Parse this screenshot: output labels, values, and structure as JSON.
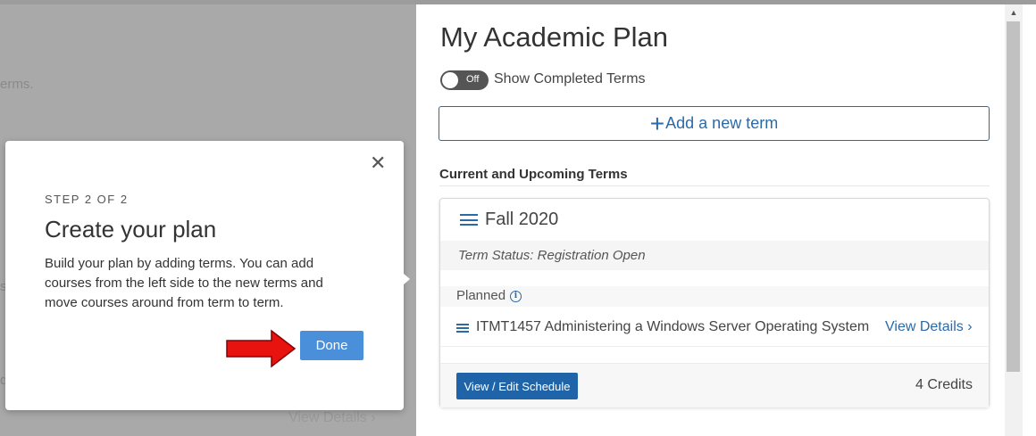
{
  "background": {
    "terms_fragment": "erms.",
    "fragment_s": "s",
    "fragment_q": "q",
    "view_details": "View Details"
  },
  "header": {
    "title": "My Academic Plan"
  },
  "toggle": {
    "state_text": "Off",
    "label": "Show Completed Terms"
  },
  "add_term": {
    "label": "Add a new term",
    "icon": "plus-icon"
  },
  "section": {
    "heading": "Current and Upcoming Terms"
  },
  "term": {
    "title": "Fall 2020",
    "status": "Term Status: Registration Open",
    "planned_label": "Planned",
    "courses": [
      {
        "name": "ITMT1457 Administering a Windows Server Operating System",
        "action": "View Details"
      }
    ],
    "schedule_button": "View / Edit Schedule",
    "credits": "4 Credits"
  },
  "popover": {
    "step": "STEP 2 OF 2",
    "title": "Create your plan",
    "body": "Build your plan by adding terms. You can add courses from the left side to the new terms and move courses around from term to term.",
    "done_label": "Done",
    "close_icon": "close-icon"
  },
  "colors": {
    "accent": "#2a6aa8",
    "primary_button": "#1f64a8",
    "done_button": "#4a8fd9",
    "annotation_arrow": "#e8120e",
    "overlay": "#a9a9a9"
  }
}
